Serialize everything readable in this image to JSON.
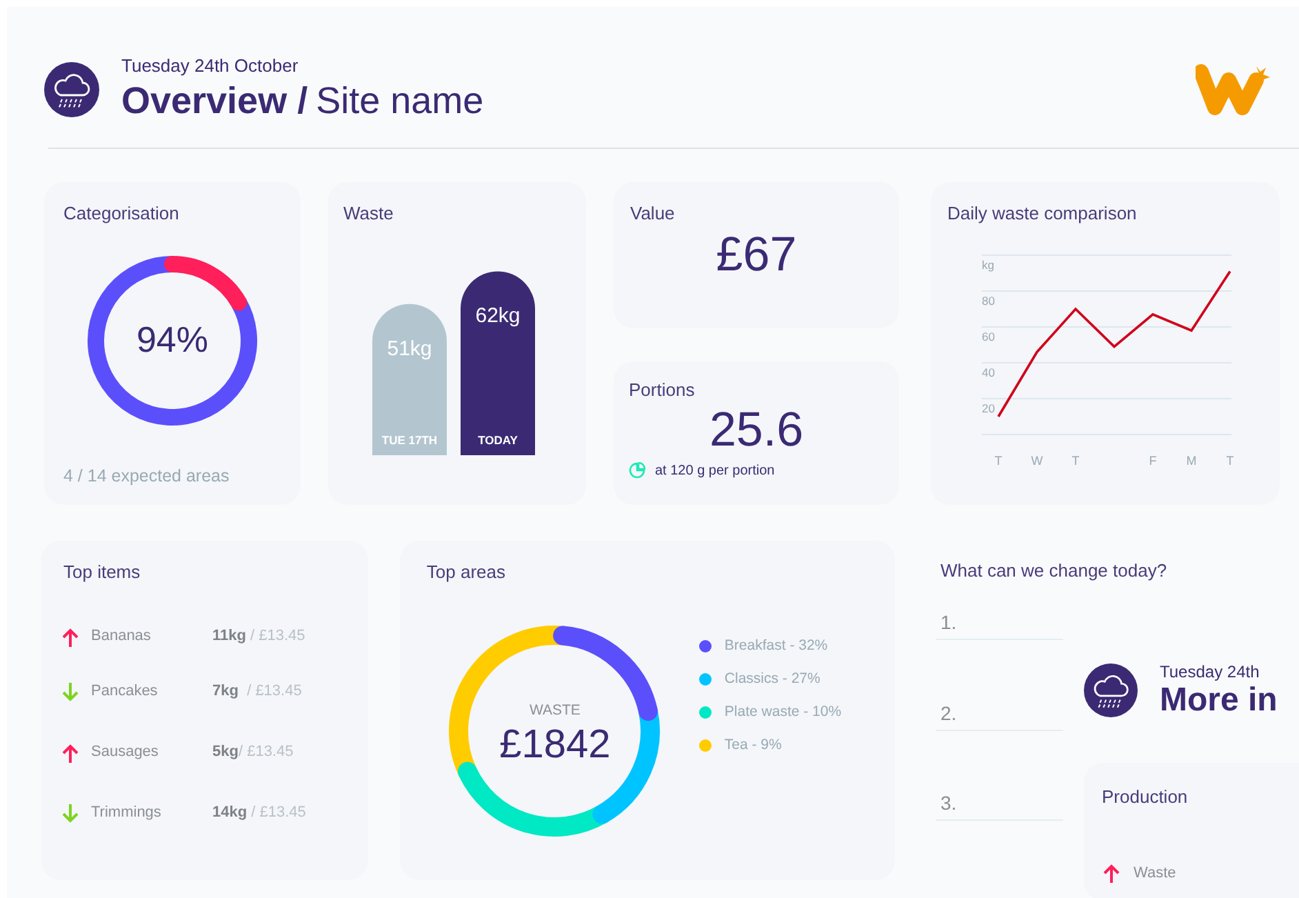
{
  "header": {
    "date": "Tuesday 24th October",
    "title_bold": "Overview /",
    "title_rest": "Site name"
  },
  "categorisation": {
    "title": "Categorisation",
    "reading": "94%",
    "footer": "4 / 14 expected areas"
  },
  "waste": {
    "title": "Waste",
    "chart_data": {
      "type": "bar",
      "categories": [
        "TUE 17TH",
        "TODAY"
      ],
      "values": [
        51,
        62
      ],
      "colors": [
        "#b3c6cf",
        "#3b2a73"
      ],
      "value_labels": [
        "51kg",
        "62kg"
      ]
    }
  },
  "value": {
    "title": "Value",
    "amount": "£67"
  },
  "portions": {
    "title": "Portions",
    "amount": "25.6",
    "note": "at 120 g per portion"
  },
  "daily": {
    "title": "Daily waste comparison",
    "chart_data": {
      "type": "line",
      "grid": true,
      "categories": [
        "T",
        "W",
        "T",
        null,
        "F",
        "M",
        "T"
      ],
      "ylim": [
        0,
        100
      ],
      "yticks": [
        20,
        40,
        60,
        80,
        {
          "value": 100,
          "label": "kg"
        }
      ],
      "series": [
        {
          "color": "#d0021b",
          "values": [
            10,
            46,
            70,
            49,
            67,
            58,
            91
          ]
        }
      ]
    }
  },
  "top_items": {
    "title": "Top items",
    "rows": [
      {
        "kind": "up",
        "name": "Bananas",
        "amount": "**11kg** / £13.45"
      },
      {
        "kind": "down",
        "name": "Pancakes",
        "amount": "**7kg**  / £13.45"
      },
      {
        "kind": "up",
        "name": "Sausages",
        "amount": "**5kg**/ £13.45"
      },
      {
        "kind": "down",
        "name": "Trimmings",
        "amount": "**14kg** / £13.45"
      }
    ]
  },
  "top_areas": {
    "title": "Top areas",
    "center_label": "WASTE",
    "center_value": "£1842",
    "legend": [
      {
        "label": "Breakfast - 32%",
        "color": "#5b4ffc"
      },
      {
        "label": "Classics - 27%",
        "color": "#00c4ff"
      },
      {
        "label": "Plate waste - 10%",
        "color": "#00e8c4"
      },
      {
        "label": "Tea - 9%",
        "color": "#ffcc00"
      }
    ]
  },
  "changes": {
    "title": "What can we change today?",
    "items": [
      "1.",
      "2.",
      "3."
    ]
  },
  "second_header": {
    "date": "Tuesday 24th",
    "title": "More in"
  },
  "production": {
    "title": "Production",
    "rows": [
      {
        "kind": "up",
        "name": "Waste"
      }
    ]
  }
}
